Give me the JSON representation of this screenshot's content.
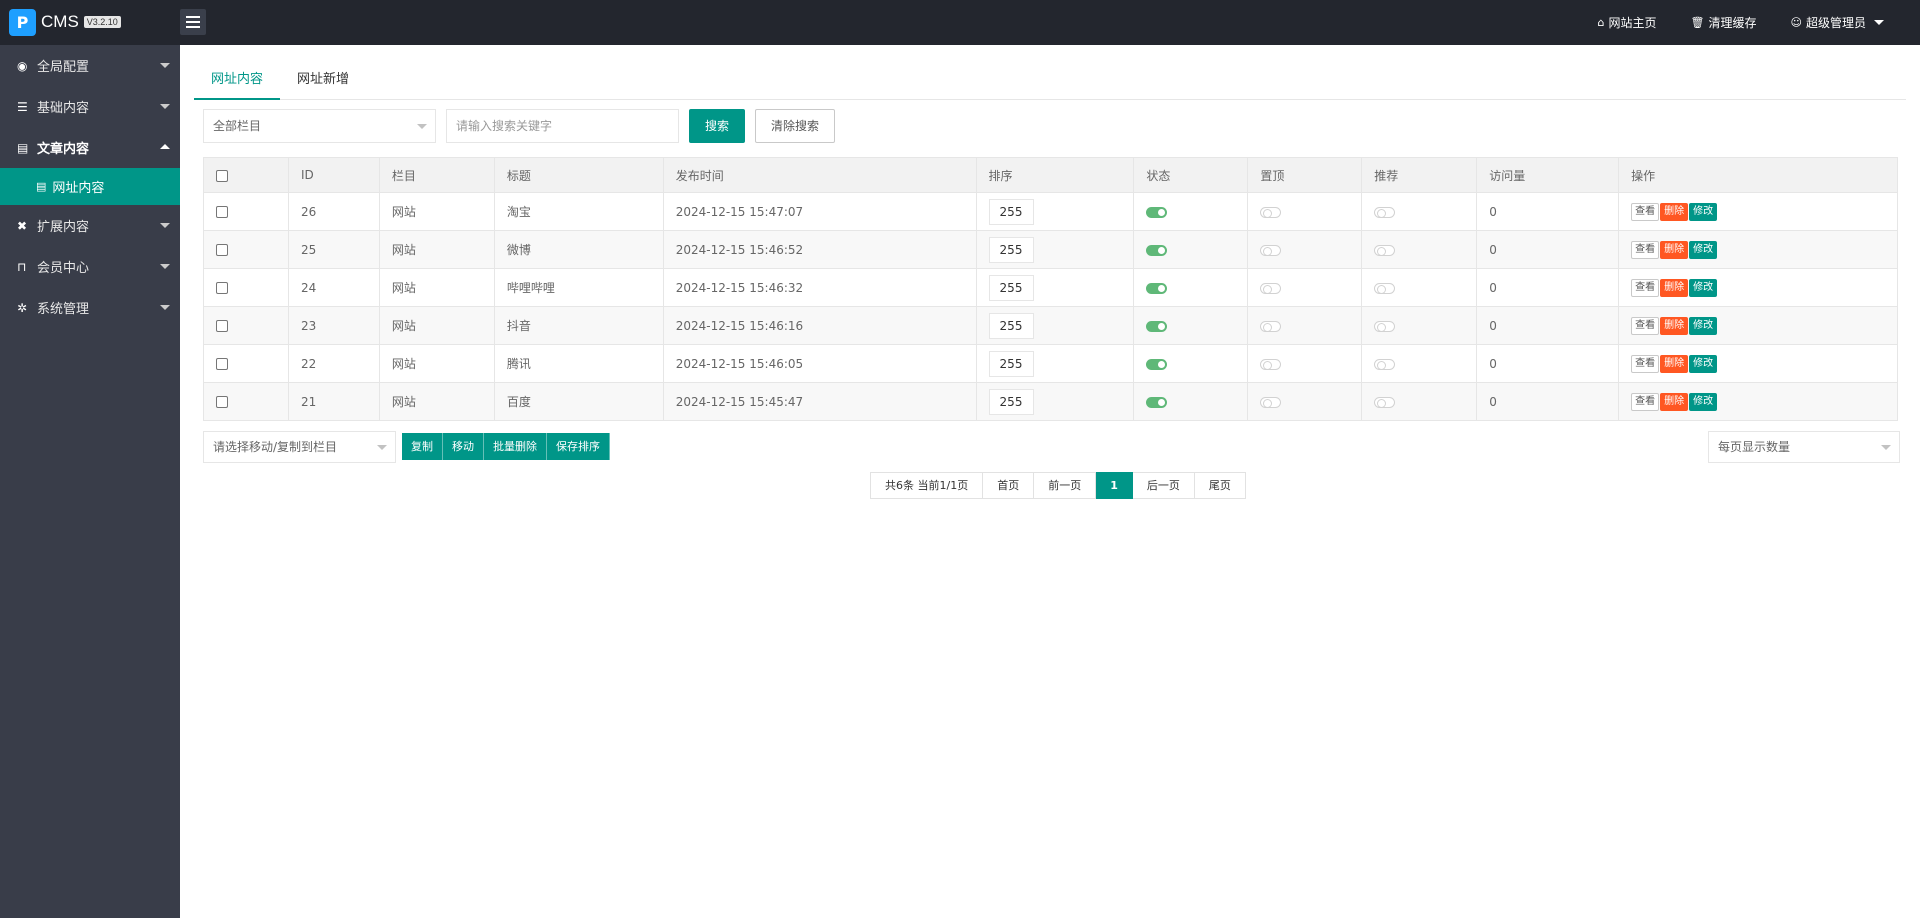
{
  "header": {
    "logo_text": "CMS",
    "version": "V3.2.10",
    "links": [
      {
        "icon": "home-icon",
        "label": "网站主页"
      },
      {
        "icon": "trash-icon",
        "label": "清理缓存"
      },
      {
        "icon": "user-icon",
        "label": "超级管理员"
      }
    ]
  },
  "sidebar": {
    "items": [
      {
        "label": "全局配置",
        "icon": "globe-icon"
      },
      {
        "label": "基础内容",
        "icon": "sliders-icon"
      },
      {
        "label": "文章内容",
        "icon": "file-icon"
      },
      {
        "label": "网址内容",
        "icon": "file-icon"
      },
      {
        "label": "扩展内容",
        "icon": "expand-icon"
      },
      {
        "label": "会员中心",
        "icon": "lock-icon"
      },
      {
        "label": "系统管理",
        "icon": "gear-icon"
      }
    ]
  },
  "tabs": [
    "网址内容",
    "网址新增"
  ],
  "filter": {
    "category_select": "全部栏目",
    "search_placeholder": "请输入搜索关键字",
    "search_button": "搜索",
    "clear_button": "清除搜索"
  },
  "table": {
    "headers": [
      "ID",
      "栏目",
      "标题",
      "发布时间",
      "排序",
      "状态",
      "置顶",
      "推荐",
      "访问量",
      "操作"
    ],
    "rows": [
      {
        "id": "26",
        "column": "网站",
        "title": "淘宝",
        "time": "2024-12-15 15:47:07",
        "sort": "255",
        "status": true,
        "top": false,
        "recommend": false,
        "visits": "0"
      },
      {
        "id": "25",
        "column": "网站",
        "title": "微博",
        "time": "2024-12-15 15:46:52",
        "sort": "255",
        "status": true,
        "top": false,
        "recommend": false,
        "visits": "0"
      },
      {
        "id": "24",
        "column": "网站",
        "title": "哔哩哔哩",
        "time": "2024-12-15 15:46:32",
        "sort": "255",
        "status": true,
        "top": false,
        "recommend": false,
        "visits": "0"
      },
      {
        "id": "23",
        "column": "网站",
        "title": "抖音",
        "time": "2024-12-15 15:46:16",
        "sort": "255",
        "status": true,
        "top": false,
        "recommend": false,
        "visits": "0"
      },
      {
        "id": "22",
        "column": "网站",
        "title": "腾讯",
        "time": "2024-12-15 15:46:05",
        "sort": "255",
        "status": true,
        "top": false,
        "recommend": false,
        "visits": "0"
      },
      {
        "id": "21",
        "column": "网站",
        "title": "百度",
        "time": "2024-12-15 15:45:47",
        "sort": "255",
        "status": true,
        "top": false,
        "recommend": false,
        "visits": "0"
      }
    ],
    "actions": {
      "view": "查看",
      "delete": "删除",
      "edit": "修改"
    }
  },
  "bulk": {
    "move_select": "请选择移动/复制到栏目",
    "buttons": [
      "复制",
      "移动",
      "批量删除",
      "保存排序"
    ],
    "per_page": "每页显示数量"
  },
  "pager": {
    "summary": "共6条 当前1/1页",
    "first": "首页",
    "prev": "前一页",
    "current": "1",
    "next": "后一页",
    "last": "尾页"
  },
  "colors": {
    "accent": "#009688",
    "danger": "#ff5722",
    "sidebar": "#393d49",
    "topbar": "#23262e"
  }
}
